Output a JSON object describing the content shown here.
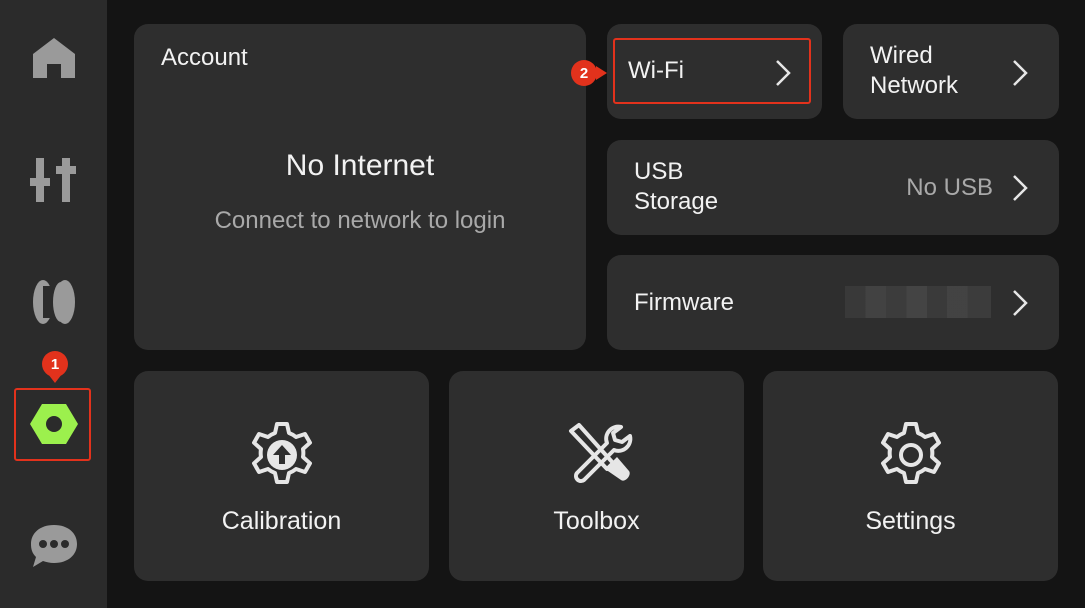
{
  "sidebar": {
    "items": [
      {
        "name": "home",
        "icon": "home-icon"
      },
      {
        "name": "controls",
        "icon": "sliders-icon"
      },
      {
        "name": "filament",
        "icon": "filament-spool-icon"
      },
      {
        "name": "settings",
        "icon": "hex-nut-icon",
        "active": true
      },
      {
        "name": "messages",
        "icon": "chat-bubble-icon"
      }
    ],
    "active_color": "#9cf04d"
  },
  "annotations": {
    "step1": "1",
    "step2": "2",
    "highlight_color": "#e2321c"
  },
  "account": {
    "title": "Account",
    "status": "No Internet",
    "hint": "Connect to network to login"
  },
  "network": {
    "wifi_label": "Wi-Fi",
    "wired_label_line1": "Wired",
    "wired_label_line2": "Network"
  },
  "usb": {
    "label_line1": "USB",
    "label_line2": "Storage",
    "value": "No USB"
  },
  "firmware": {
    "label": "Firmware"
  },
  "tiles": [
    {
      "label": "Calibration",
      "icon": "gear-upload-icon"
    },
    {
      "label": "Toolbox",
      "icon": "wrench-screwdriver-icon"
    },
    {
      "label": "Settings",
      "icon": "gear-icon"
    }
  ]
}
